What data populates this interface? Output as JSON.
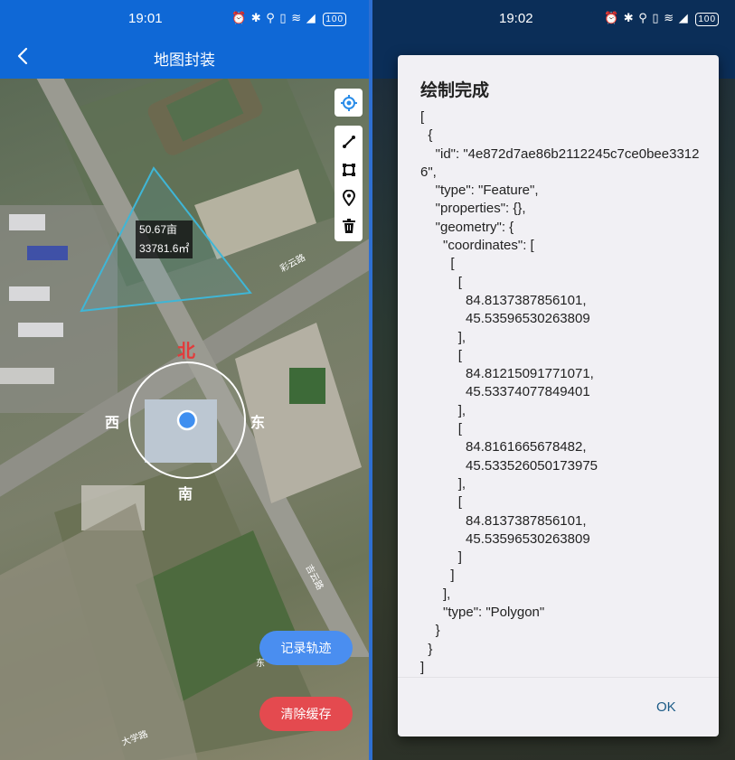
{
  "left": {
    "status": {
      "time": "19:01",
      "icons": "⏰ ✱ ⚲ ▯ ≋ ◢",
      "battery": "100"
    },
    "title": "地图封装",
    "measure": {
      "area_mu": "50.67亩",
      "area_m2": "33781.6㎡"
    },
    "compass": {
      "north": "北",
      "south": "南",
      "east": "东",
      "west": "西"
    },
    "buttons": {
      "record": "记录轨迹",
      "clear": "清除缓存"
    },
    "map_labels": {
      "road1": "彩云路",
      "road2": "吉云路",
      "road3": "东",
      "road4": "大学路"
    }
  },
  "right": {
    "status": {
      "time": "19:02",
      "icons": "⏰ ✱ ⚲ ▯ ≋ ◢",
      "battery": "100"
    },
    "dialog": {
      "title": "绘制完成",
      "body": "[\n  {\n    \"id\": \"4e872d7ae86b2112245c7ce0bee33126\",\n    \"type\": \"Feature\",\n    \"properties\": {},\n    \"geometry\": {\n      \"coordinates\": [\n        [\n          [\n            84.8137387856101,\n            45.53596530263809\n          ],\n          [\n            84.81215091771071,\n            45.53374077849401\n          ],\n          [\n            84.8161665678482,\n            45.533526050173975\n          ],\n          [\n            84.8137387856101,\n            45.53596530263809\n          ]\n        ]\n      ],\n      \"type\": \"Polygon\"\n    }\n  }\n]",
      "ok": "OK"
    }
  },
  "colors": {
    "appbar": "#0f68d6",
    "record": "#4a8ef0",
    "clear": "#e44a4f",
    "polygon": "#3fb6d6",
    "ok": "#1a5a86"
  }
}
